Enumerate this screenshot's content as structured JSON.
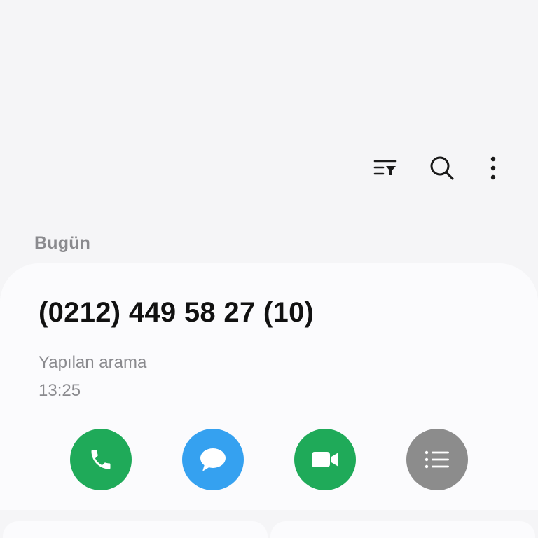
{
  "toolbar": {
    "filter_icon": "filter-list-icon",
    "search_icon": "search-icon",
    "more_icon": "more-vert-icon"
  },
  "section": {
    "label": "Bugün"
  },
  "call_entry": {
    "number": "(0212) 449 58 27 (10)",
    "type": "Yapılan arama",
    "time": "13:25"
  },
  "actions": [
    {
      "name": "call",
      "icon": "phone-icon",
      "color": "#1faa59"
    },
    {
      "name": "message",
      "icon": "message-bubble-icon",
      "color": "#35a1f0"
    },
    {
      "name": "video",
      "icon": "video-camera-icon",
      "color": "#1faa59"
    },
    {
      "name": "details",
      "icon": "list-icon",
      "color": "#8c8c8c"
    }
  ],
  "colors": {
    "background": "#f5f5f7",
    "card": "#fbfbfd",
    "text_primary": "#111111",
    "text_secondary": "#8a8a8e"
  }
}
